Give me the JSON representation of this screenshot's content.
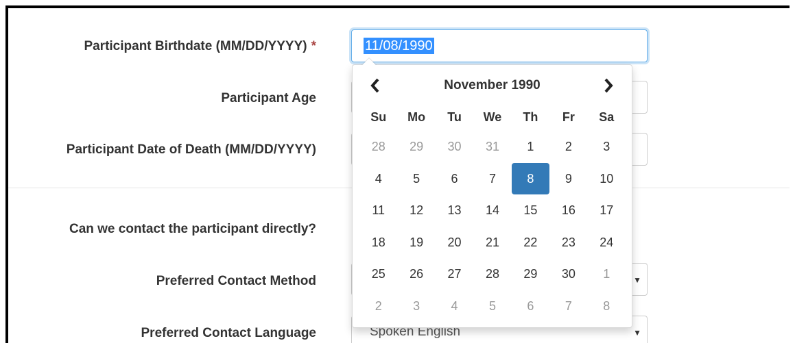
{
  "form": {
    "birthdate": {
      "label": "Participant Birthdate (MM/DD/YYYY)",
      "required_mark": "*",
      "value": "11/08/1990"
    },
    "age": {
      "label": "Participant Age"
    },
    "date_of_death": {
      "label": "Participant Date of Death (MM/DD/YYYY)"
    },
    "contact_directly": {
      "label": "Can we contact the participant directly?"
    },
    "contact_method": {
      "label": "Preferred Contact Method",
      "value": ""
    },
    "contact_language": {
      "label": "Preferred Contact Language",
      "value": "Spoken English"
    }
  },
  "datepicker": {
    "title": "November 1990",
    "prev_icon": "chevron-left-icon",
    "next_icon": "chevron-right-icon",
    "weekdays": [
      "Su",
      "Mo",
      "Tu",
      "We",
      "Th",
      "Fr",
      "Sa"
    ],
    "weeks": [
      [
        {
          "d": "28",
          "m": true
        },
        {
          "d": "29",
          "m": true
        },
        {
          "d": "30",
          "m": true
        },
        {
          "d": "31",
          "m": true
        },
        {
          "d": "1"
        },
        {
          "d": "2"
        },
        {
          "d": "3"
        }
      ],
      [
        {
          "d": "4"
        },
        {
          "d": "5"
        },
        {
          "d": "6"
        },
        {
          "d": "7"
        },
        {
          "d": "8",
          "a": true
        },
        {
          "d": "9"
        },
        {
          "d": "10"
        }
      ],
      [
        {
          "d": "11"
        },
        {
          "d": "12"
        },
        {
          "d": "13"
        },
        {
          "d": "14"
        },
        {
          "d": "15"
        },
        {
          "d": "16"
        },
        {
          "d": "17"
        }
      ],
      [
        {
          "d": "18"
        },
        {
          "d": "19"
        },
        {
          "d": "20"
        },
        {
          "d": "21"
        },
        {
          "d": "22"
        },
        {
          "d": "23"
        },
        {
          "d": "24"
        }
      ],
      [
        {
          "d": "25"
        },
        {
          "d": "26"
        },
        {
          "d": "27"
        },
        {
          "d": "28"
        },
        {
          "d": "29"
        },
        {
          "d": "30"
        },
        {
          "d": "1",
          "m": true
        }
      ],
      [
        {
          "d": "2",
          "m": true
        },
        {
          "d": "3",
          "m": true
        },
        {
          "d": "4",
          "m": true
        },
        {
          "d": "5",
          "m": true
        },
        {
          "d": "6",
          "m": true
        },
        {
          "d": "7",
          "m": true
        },
        {
          "d": "8",
          "m": true
        }
      ]
    ],
    "active_color": "#337ab7"
  }
}
